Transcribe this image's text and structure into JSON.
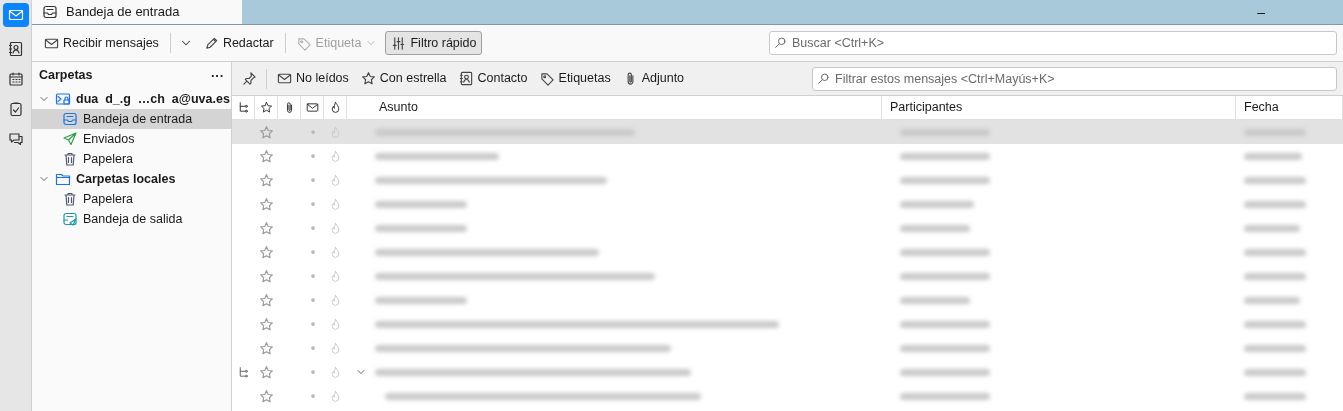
{
  "tab": {
    "title": "Bandeja de entrada"
  },
  "window_controls": [
    "–"
  ],
  "toolbar": {
    "buttons": [
      {
        "label": "Recibir mensajes",
        "kind": "get",
        "disabled": false
      },
      {
        "label": "Redactar",
        "kind": "write",
        "disabled": false
      },
      {
        "label": "Etiqueta",
        "kind": "tag",
        "disabled": true
      },
      {
        "label": "Filtro rápido",
        "kind": "filter",
        "disabled": false,
        "pressed": true
      }
    ],
    "search": {
      "placeholder": "Buscar <Ctrl+K>"
    }
  },
  "folder_pane": {
    "title": "Carpetas",
    "menu": "···",
    "tree": [
      {
        "label": "dua  d_.g  …ch  a@uva.es",
        "kind": "account",
        "expanded": true,
        "children": [
          {
            "label": "Bandeja de entrada",
            "kind": "inbox",
            "selected": true
          },
          {
            "label": "Enviados",
            "kind": "sent",
            "selected": false
          },
          {
            "label": "Papelera",
            "kind": "trash",
            "selected": false
          }
        ]
      },
      {
        "label": "Carpetas locales",
        "kind": "local",
        "expanded": true,
        "children": [
          {
            "label": "Papelera",
            "kind": "trash",
            "selected": false
          },
          {
            "label": "Bandeja de salida",
            "kind": "outbox",
            "selected": false
          }
        ]
      }
    ]
  },
  "quick_filter": {
    "filters": [
      {
        "label": "No leídos",
        "kind": "unread"
      },
      {
        "label": "Con estrella",
        "kind": "star"
      },
      {
        "label": "Contacto",
        "kind": "contact"
      },
      {
        "label": "Etiquetas",
        "kind": "tag"
      },
      {
        "label": "Adjunto",
        "kind": "attach"
      }
    ],
    "search": {
      "placeholder": "Filtrar estos mensajes <Ctrl+Mayús+K>"
    }
  },
  "table": {
    "columns": [
      "Asunto",
      "Participantes",
      "Fecha"
    ],
    "rows": [
      {
        "selected": true
      },
      {
        "selected": false
      },
      {
        "selected": false
      },
      {
        "selected": false
      },
      {
        "selected": false
      },
      {
        "selected": false
      },
      {
        "selected": false
      },
      {
        "selected": false
      },
      {
        "selected": false
      },
      {
        "selected": false
      },
      {
        "selected": false,
        "expanded": true,
        "children": [
          {
            "selected": false
          }
        ]
      }
    ]
  }
}
